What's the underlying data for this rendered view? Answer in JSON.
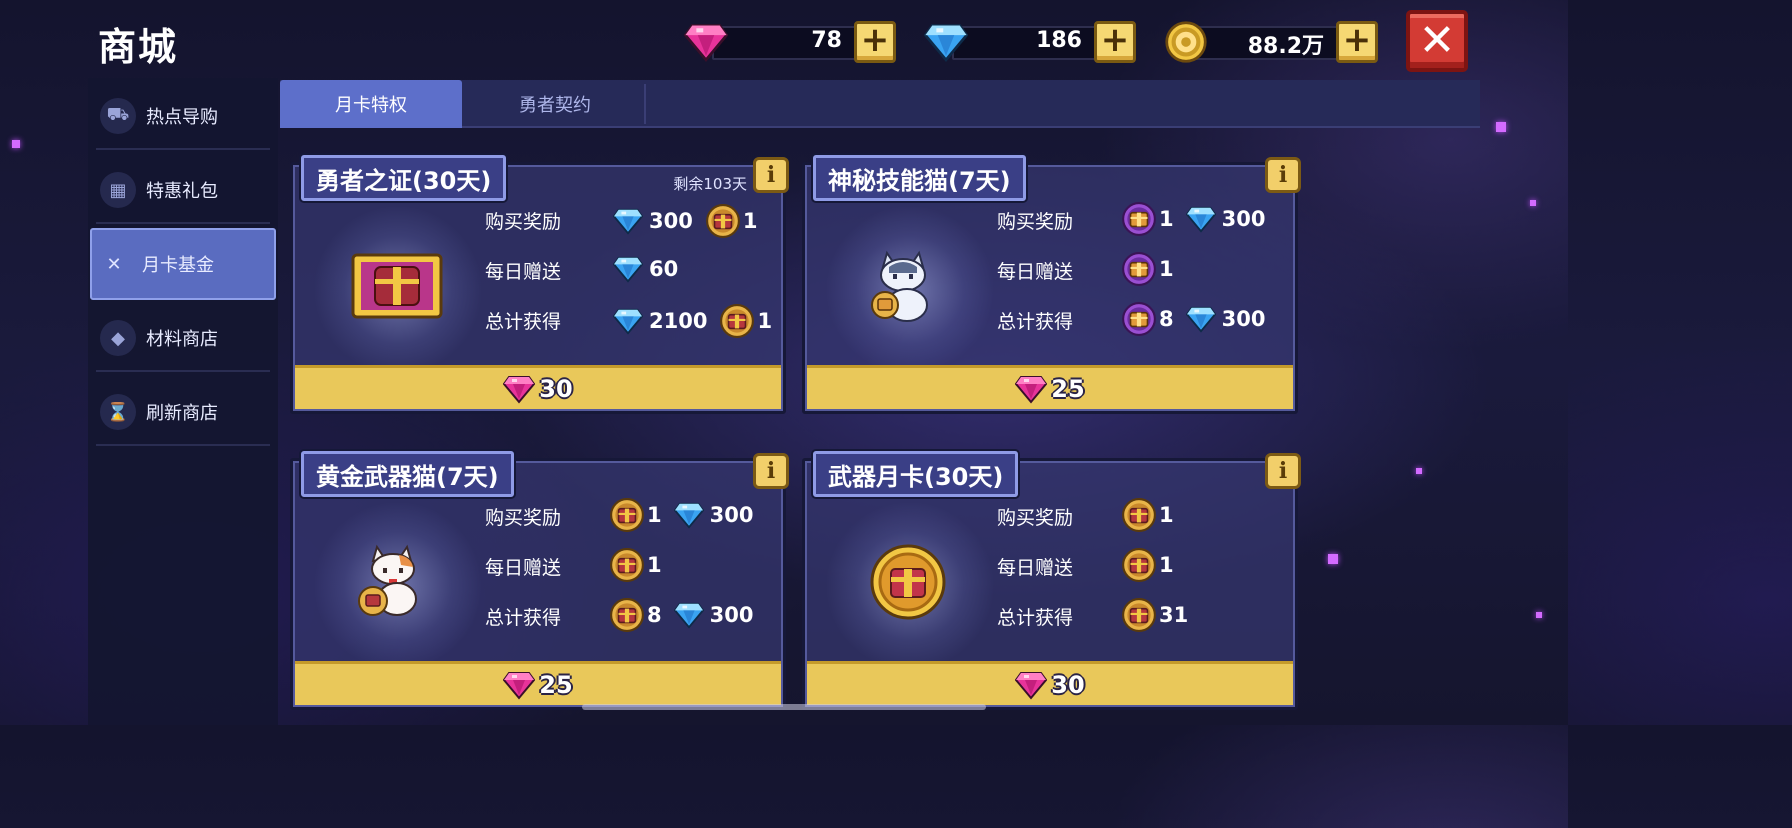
{
  "header": {
    "title": "商城"
  },
  "currencies": [
    {
      "name": "pink-gem",
      "value": "78"
    },
    {
      "name": "blue-diamond",
      "value": "186"
    },
    {
      "name": "gold-coin",
      "value": "88.2万"
    }
  ],
  "sidebar": {
    "items": [
      {
        "label": "热点导购",
        "icon": "cart-icon"
      },
      {
        "label": "特惠礼包",
        "icon": "gift-icon"
      },
      {
        "label": "月卡基金",
        "icon": "card-icon",
        "active": true
      },
      {
        "label": "材料商店",
        "icon": "gem-stack-icon"
      },
      {
        "label": "刷新商店",
        "icon": "hourglass-icon"
      }
    ]
  },
  "tabs": [
    {
      "label": "月卡特权",
      "active": true
    },
    {
      "label": "勇者契约",
      "active": false
    }
  ],
  "labels": {
    "buy_reward": "购买奖励",
    "daily_gift": "每日赠送",
    "total_gain": "总计获得"
  },
  "cards": [
    {
      "title": "勇者之证(30天)",
      "remaining": "剩余103天",
      "buy": {
        "a": "300",
        "b": "1"
      },
      "daily": {
        "a": "60"
      },
      "total": {
        "a": "2100",
        "b": "1"
      },
      "price": "30"
    },
    {
      "title": "神秘技能猫(7天)",
      "buy": {
        "a": "1",
        "b": "300"
      },
      "daily": {
        "a": "1"
      },
      "total": {
        "a": "8",
        "b": "300"
      },
      "price": "25"
    },
    {
      "title": "黄金武器猫(7天)",
      "buy": {
        "a": "1",
        "b": "300"
      },
      "daily": {
        "a": "1"
      },
      "total": {
        "a": "8",
        "b": "300"
      },
      "price": "25"
    },
    {
      "title": "武器月卡(30天)",
      "buy": {
        "a": "1"
      },
      "daily": {
        "a": "1"
      },
      "total": {
        "a": "31"
      },
      "price": "30"
    }
  ],
  "colors": {
    "pink_gem": "#e8339a",
    "diamond": "#4fb8ff",
    "gold": "#f2c744",
    "close_red": "#d33b34",
    "price_bar": "#e9c85a"
  }
}
